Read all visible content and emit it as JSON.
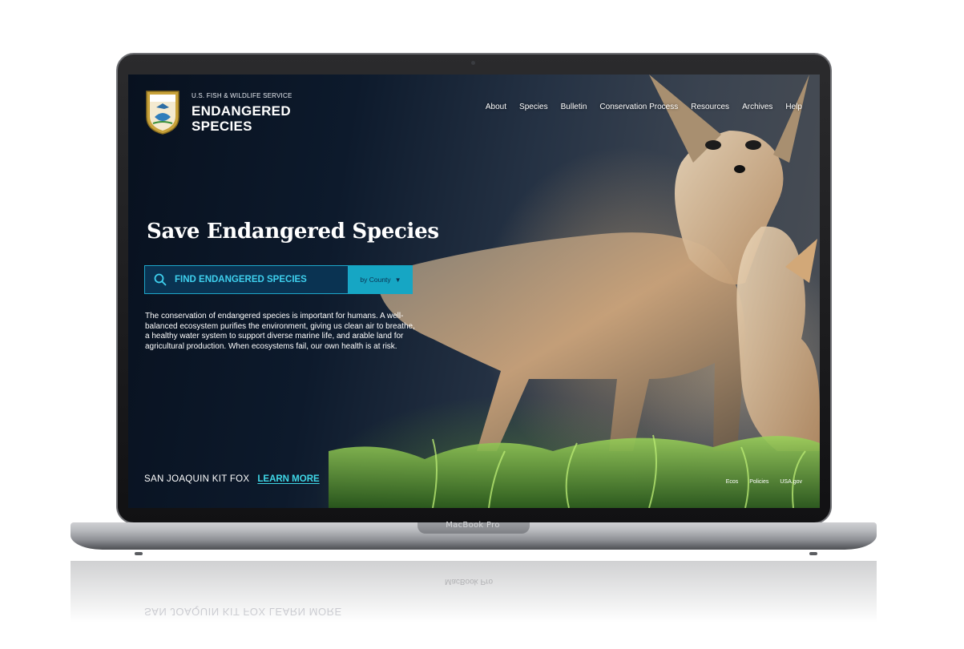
{
  "header": {
    "org_name": "U.S. FISH & WILDLIFE SERVICE",
    "title_line1": "ENDANGERED",
    "title_line2": "SPECIES",
    "nav": [
      "About",
      "Species",
      "Bulletin",
      "Conservation Process",
      "Resources",
      "Archives",
      "Help"
    ]
  },
  "hero": {
    "headline": "Save Endangered Species",
    "search_placeholder": "FIND ENDANGERED SPECIES",
    "filter_label": "by County",
    "description": "The conservation of endangered species is important for humans. A well-balanced ecosystem purifies the environment, giving us clean air to breathe, a healthy water system to support diverse marine life, and arable land for agricultural production. When ecosystems fail, our own health is at risk.",
    "species_name": "SAN JOAQUIN KIT FOX",
    "learn_more": "LEARN MORE"
  },
  "footer": {
    "links": [
      "Ecos",
      "Policies",
      "USA.gov"
    ]
  },
  "device": {
    "label": "MacBook Pro"
  },
  "colors": {
    "accent": "#16a6c4",
    "search_bg": "#0a3352",
    "link": "#3fd6e6"
  }
}
